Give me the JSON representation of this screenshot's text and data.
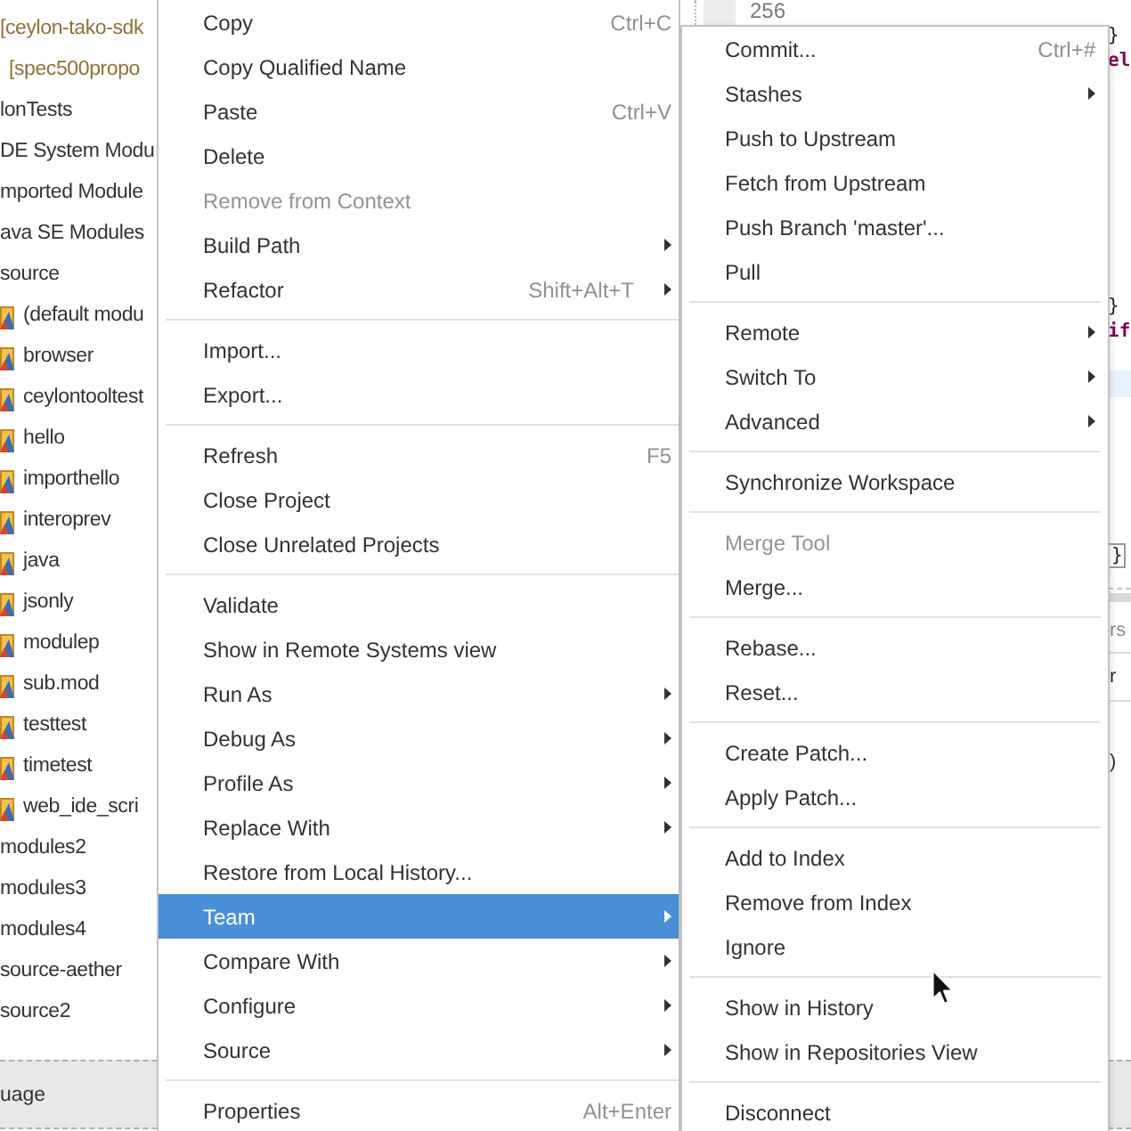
{
  "sidebar": {
    "items": [
      {
        "kind": "decoration",
        "label": "[ceylon-tako-sdk"
      },
      {
        "kind": "decoration",
        "label": "[spec500propo"
      },
      {
        "kind": "plain",
        "label": "lonTests"
      },
      {
        "kind": "plain",
        "label": "DE System Modu"
      },
      {
        "kind": "plain",
        "label": "mported Module"
      },
      {
        "kind": "plain",
        "label": "ava SE Modules"
      },
      {
        "kind": "plain",
        "label": "source",
        "children": [
          {
            "kind": "module",
            "label": "(default modu"
          },
          {
            "kind": "module",
            "label": "browser"
          },
          {
            "kind": "module",
            "label": "ceylontooltest"
          },
          {
            "kind": "module",
            "label": "hello"
          },
          {
            "kind": "module",
            "label": "importhello"
          },
          {
            "kind": "module",
            "label": "interoprev"
          },
          {
            "kind": "module",
            "label": "java"
          },
          {
            "kind": "module",
            "label": "jsonly"
          },
          {
            "kind": "module",
            "label": "modulep"
          },
          {
            "kind": "module",
            "label": "sub.mod"
          },
          {
            "kind": "module",
            "label": "testtest"
          },
          {
            "kind": "module",
            "label": "timetest"
          },
          {
            "kind": "module",
            "label": "web_ide_scri"
          }
        ]
      },
      {
        "kind": "plain",
        "label": "modules2"
      },
      {
        "kind": "plain",
        "label": "modules3"
      },
      {
        "kind": "plain",
        "label": "modules4"
      },
      {
        "kind": "plain",
        "label": "source-aether"
      },
      {
        "kind": "plain",
        "label": "source2"
      }
    ]
  },
  "editor": {
    "line_number": "256",
    "lines": [
      {
        "kind": "brace",
        "text": "}"
      },
      {
        "kind": "keyword",
        "text": "el"
      },
      {
        "kind": "brace",
        "text": "}"
      },
      {
        "kind": "keyword",
        "text": "if"
      },
      {
        "kind": "current-line"
      },
      {
        "kind": "matched-brace",
        "text": "}"
      }
    ]
  },
  "lower_panel": {
    "tab": "rs",
    "column_header": "r",
    "cell": ")"
  },
  "bottom_bar": {
    "label": "uage"
  },
  "context_menu": {
    "items": [
      {
        "kind": "item",
        "label": "Copy",
        "shortcut": "Ctrl+C",
        "selected": false,
        "disabled": false,
        "submenu": false
      },
      {
        "kind": "item",
        "label": "Copy Qualified Name",
        "selected": false,
        "disabled": false,
        "submenu": false
      },
      {
        "kind": "item",
        "label": "Paste",
        "shortcut": "Ctrl+V",
        "selected": false,
        "disabled": false,
        "submenu": false
      },
      {
        "kind": "item",
        "label": "Delete",
        "selected": false,
        "disabled": false,
        "submenu": false
      },
      {
        "kind": "item",
        "label": "Remove from Context",
        "selected": false,
        "disabled": true,
        "submenu": false
      },
      {
        "kind": "item",
        "label": "Build Path",
        "selected": false,
        "disabled": false,
        "submenu": true
      },
      {
        "kind": "item",
        "label": "Refactor",
        "shortcut": "Shift+Alt+T",
        "selected": false,
        "disabled": false,
        "submenu": true
      },
      {
        "kind": "separator"
      },
      {
        "kind": "item",
        "label": "Import...",
        "selected": false,
        "disabled": false,
        "submenu": false
      },
      {
        "kind": "item",
        "label": "Export...",
        "selected": false,
        "disabled": false,
        "submenu": false
      },
      {
        "kind": "separator"
      },
      {
        "kind": "item",
        "label": "Refresh",
        "shortcut": "F5",
        "selected": false,
        "disabled": false,
        "submenu": false
      },
      {
        "kind": "item",
        "label": "Close Project",
        "selected": false,
        "disabled": false,
        "submenu": false
      },
      {
        "kind": "item",
        "label": "Close Unrelated Projects",
        "selected": false,
        "disabled": false,
        "submenu": false
      },
      {
        "kind": "separator"
      },
      {
        "kind": "item",
        "label": "Validate",
        "selected": false,
        "disabled": false,
        "submenu": false
      },
      {
        "kind": "item",
        "label": "Show in Remote Systems view",
        "selected": false,
        "disabled": false,
        "submenu": false
      },
      {
        "kind": "item",
        "label": "Run As",
        "selected": false,
        "disabled": false,
        "submenu": true
      },
      {
        "kind": "item",
        "label": "Debug As",
        "selected": false,
        "disabled": false,
        "submenu": true
      },
      {
        "kind": "item",
        "label": "Profile As",
        "selected": false,
        "disabled": false,
        "submenu": true
      },
      {
        "kind": "item",
        "label": "Replace With",
        "selected": false,
        "disabled": false,
        "submenu": true
      },
      {
        "kind": "item",
        "label": "Restore from Local History...",
        "selected": false,
        "disabled": false,
        "submenu": false
      },
      {
        "kind": "item",
        "label": "Team",
        "selected": true,
        "disabled": false,
        "submenu": true
      },
      {
        "kind": "item",
        "label": "Compare With",
        "selected": false,
        "disabled": false,
        "submenu": true
      },
      {
        "kind": "item",
        "label": "Configure",
        "selected": false,
        "disabled": false,
        "submenu": true
      },
      {
        "kind": "item",
        "label": "Source",
        "selected": false,
        "disabled": false,
        "submenu": true
      },
      {
        "kind": "separator"
      },
      {
        "kind": "item",
        "label": "Properties",
        "shortcut": "Alt+Enter",
        "selected": false,
        "disabled": false,
        "submenu": false
      }
    ]
  },
  "team_submenu": {
    "items": [
      {
        "kind": "item",
        "label": "Commit...",
        "shortcut": "Ctrl+#",
        "selected": false,
        "disabled": false,
        "submenu": false
      },
      {
        "kind": "item",
        "label": "Stashes",
        "selected": false,
        "disabled": false,
        "submenu": true
      },
      {
        "kind": "item",
        "label": "Push to Upstream",
        "selected": false,
        "disabled": false,
        "submenu": false
      },
      {
        "kind": "item",
        "label": "Fetch from Upstream",
        "selected": false,
        "disabled": false,
        "submenu": false
      },
      {
        "kind": "item",
        "label": "Push Branch 'master'...",
        "selected": false,
        "disabled": false,
        "submenu": false
      },
      {
        "kind": "item",
        "label": "Pull",
        "selected": false,
        "disabled": false,
        "submenu": false
      },
      {
        "kind": "separator"
      },
      {
        "kind": "item",
        "label": "Remote",
        "selected": false,
        "disabled": false,
        "submenu": true
      },
      {
        "kind": "item",
        "label": "Switch To",
        "selected": false,
        "disabled": false,
        "submenu": true
      },
      {
        "kind": "item",
        "label": "Advanced",
        "selected": false,
        "disabled": false,
        "submenu": true
      },
      {
        "kind": "separator"
      },
      {
        "kind": "item",
        "label": "Synchronize Workspace",
        "selected": false,
        "disabled": false,
        "submenu": false
      },
      {
        "kind": "separator"
      },
      {
        "kind": "item",
        "label": "Merge Tool",
        "selected": false,
        "disabled": true,
        "submenu": false
      },
      {
        "kind": "item",
        "label": "Merge...",
        "selected": false,
        "disabled": false,
        "submenu": false
      },
      {
        "kind": "separator"
      },
      {
        "kind": "item",
        "label": "Rebase...",
        "selected": false,
        "disabled": false,
        "submenu": false
      },
      {
        "kind": "item",
        "label": "Reset...",
        "selected": false,
        "disabled": false,
        "submenu": false
      },
      {
        "kind": "separator"
      },
      {
        "kind": "item",
        "label": "Create Patch...",
        "selected": false,
        "disabled": false,
        "submenu": false
      },
      {
        "kind": "item",
        "label": "Apply Patch...",
        "selected": false,
        "disabled": false,
        "submenu": false
      },
      {
        "kind": "separator"
      },
      {
        "kind": "item",
        "label": "Add to Index",
        "selected": false,
        "disabled": false,
        "submenu": false
      },
      {
        "kind": "item",
        "label": "Remove from Index",
        "selected": false,
        "disabled": false,
        "submenu": false
      },
      {
        "kind": "item",
        "label": "Ignore",
        "selected": false,
        "disabled": false,
        "submenu": false
      },
      {
        "kind": "separator"
      },
      {
        "kind": "item",
        "label": "Show in History",
        "selected": false,
        "disabled": false,
        "submenu": false
      },
      {
        "kind": "item",
        "label": "Show in Repositories View",
        "selected": false,
        "disabled": false,
        "submenu": false
      },
      {
        "kind": "separator"
      },
      {
        "kind": "item",
        "label": "Disconnect",
        "selected": false,
        "disabled": false,
        "submenu": false
      }
    ]
  }
}
